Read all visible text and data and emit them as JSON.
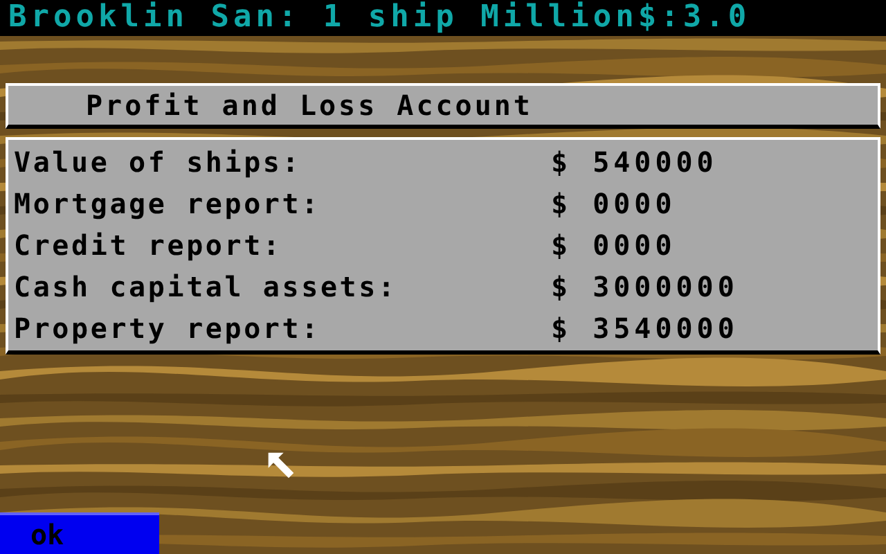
{
  "status_bar": {
    "text": "Brooklin San: 1 ship Million$:3.0"
  },
  "panel": {
    "title": "Profit and Loss Account",
    "rows": [
      {
        "label": "Value of ships:",
        "value": "$ 540000"
      },
      {
        "label": "Mortgage report:",
        "value": "$ 0000"
      },
      {
        "label": "Credit report:",
        "value": "$ 0000"
      },
      {
        "label": "Cash capital assets:",
        "value": "$ 3000000"
      },
      {
        "label": "Property report:",
        "value": "$ 3540000"
      }
    ]
  },
  "buttons": [
    {
      "label": "ok"
    }
  ]
}
